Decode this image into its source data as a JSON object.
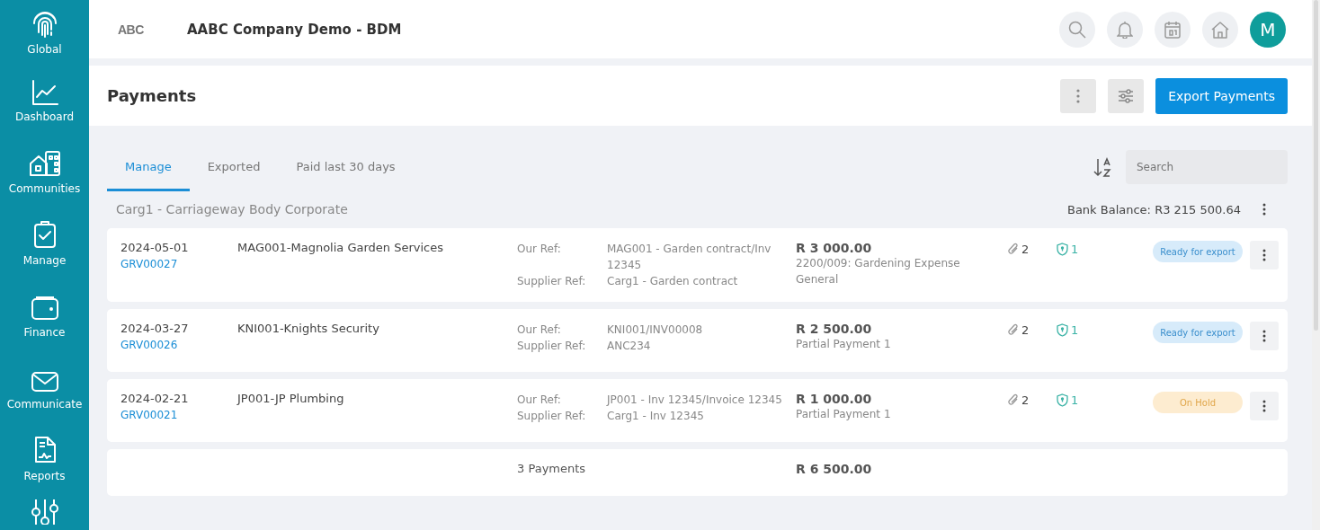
{
  "sidebar": {
    "items": [
      {
        "label": "Global"
      },
      {
        "label": "Dashboard"
      },
      {
        "label": "Communities"
      },
      {
        "label": "Manage"
      },
      {
        "label": "Finance"
      },
      {
        "label": "Communicate"
      },
      {
        "label": "Reports"
      }
    ]
  },
  "header": {
    "logo": "ABC",
    "title": "AABC Company Demo - BDM",
    "avatar": "M"
  },
  "page": {
    "title": "Payments",
    "export_button": "Export Payments"
  },
  "tabs": [
    {
      "label": "Manage",
      "selected": true
    },
    {
      "label": "Exported",
      "selected": false
    },
    {
      "label": "Paid last 30 days",
      "selected": false
    }
  ],
  "search": {
    "placeholder": "Search"
  },
  "group": {
    "name": "Carg1 - Carriageway Body Corporate",
    "bank_balance": "Bank Balance: R3 215 500.64"
  },
  "payments": [
    {
      "date": "2024-05-01",
      "grv": "GRV00027",
      "supplier": "MAG001-Magnolia Garden Services",
      "our_ref_label": "Our Ref:",
      "our_ref": "MAG001 - Garden contract/Inv 12345",
      "supplier_ref_label": "Supplier Ref:",
      "supplier_ref": "Carg1 - Garden contract",
      "amount": "R 3 000.00",
      "note": "2200/009: Gardening Expense General",
      "attachments": "2",
      "approvals": "1",
      "status": {
        "label": "Ready for export",
        "kind": "ready"
      }
    },
    {
      "date": "2024-03-27",
      "grv": "GRV00026",
      "supplier": "KNI001-Knights Security",
      "our_ref_label": "Our Ref:",
      "our_ref": "KNI001/INV00008",
      "supplier_ref_label": "Supplier Ref:",
      "supplier_ref": "ANC234",
      "amount": "R 2 500.00",
      "note": "Partial Payment 1",
      "attachments": "2",
      "approvals": "1",
      "status": {
        "label": "Ready for export",
        "kind": "ready"
      }
    },
    {
      "date": "2024-02-21",
      "grv": "GRV00021",
      "supplier": "JP001-JP Plumbing",
      "our_ref_label": "Our Ref:",
      "our_ref": "JP001 - Inv 12345/Invoice 12345",
      "supplier_ref_label": "Supplier Ref:",
      "supplier_ref": "Carg1 - Inv 12345",
      "amount": "R 1 000.00",
      "note": "Partial Payment 1",
      "attachments": "2",
      "approvals": "1",
      "status": {
        "label": "On Hold",
        "kind": "hold"
      }
    }
  ],
  "summary": {
    "count": "3 Payments",
    "total": "R 6 500.00"
  }
}
